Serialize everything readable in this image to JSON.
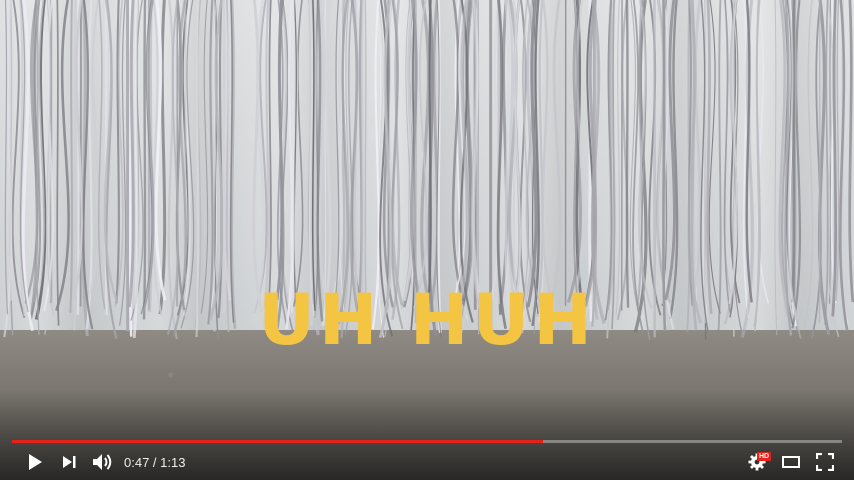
{
  "video": {
    "caption": "UH HUH",
    "caption_color": "#f4c542"
  },
  "player": {
    "progress_fraction": 0.64,
    "played_color": "#e62117",
    "current_time": "0:47",
    "separator": " / ",
    "duration": "1:13",
    "hd_badge": "HD",
    "icons": {
      "play": "play-icon",
      "next": "next-icon",
      "volume": "volume-icon",
      "settings": "gear-icon",
      "theater": "theater-mode-icon",
      "fullscreen": "fullscreen-icon"
    }
  }
}
